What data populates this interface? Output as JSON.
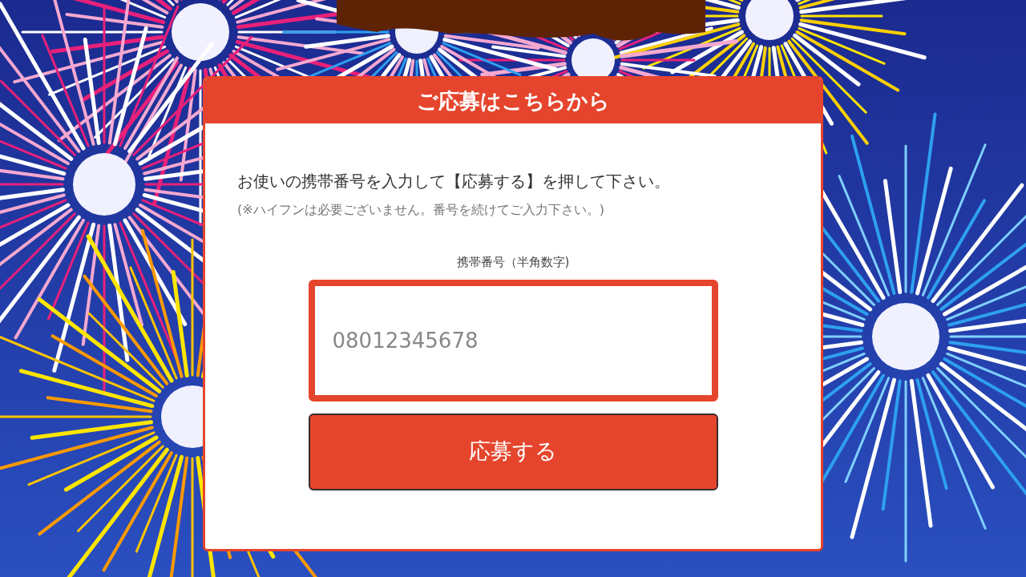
{
  "form": {
    "title": "ご応募はこちらから",
    "instruction": "お使いの携帯番号を入力して【応募する】を押して下さい。",
    "note": "(※ハイフンは必要ございません。番号を続けてご入力下さい。)",
    "field_label": "携帯番号（半角数字)",
    "phone_field": {
      "placeholder": "08012345678"
    },
    "submit_button": "応募する"
  }
}
